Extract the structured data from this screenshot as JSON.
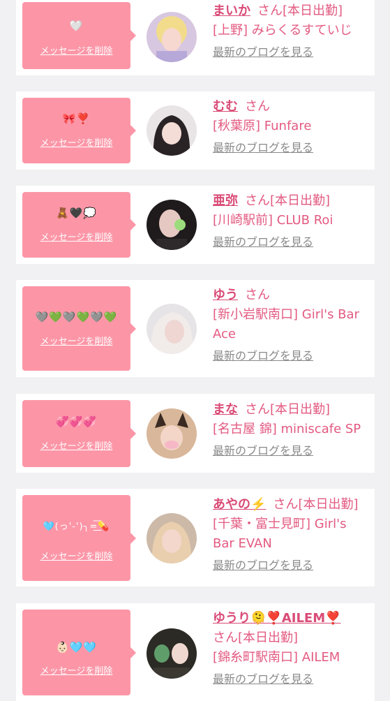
{
  "colors": {
    "accent": "#fc96a7",
    "name": "#d94b76",
    "text_pink": "#e35a81",
    "link_gray": "#8a8a8a",
    "background": "#f1f1f3"
  },
  "delete_label": "メッセージを削除",
  "blog_label": "最新のブログを見る",
  "items": [
    {
      "message": "🤍",
      "name": "まいか",
      "status": "さん[本日出勤]",
      "shop": "[上野] みらくるすていじ"
    },
    {
      "message": "🎀❣️",
      "name": "むむ",
      "status": "さん",
      "shop": "[秋葉原] Funfare"
    },
    {
      "message": "🧸🖤💭",
      "name": "亜弥",
      "status": "さん[本日出勤]",
      "shop": "[川崎駅前] CLUB Roi"
    },
    {
      "message": "🩶💚🩶💚🩶💚",
      "name": "ゆう",
      "status": "さん",
      "shop": "[新小岩駅南口] Girl's Bar Ace"
    },
    {
      "message": "💞💞💞",
      "name": "まな",
      "status": "さん[本日出勤]",
      "shop": "[名古屋 錦] miniscafe SP"
    },
    {
      "message": "🩵(っ'-')╮=͟͟͞͞💊",
      "name": "あやの⚡️",
      "status": "さん[本日出勤]",
      "shop": "[千葉・富士見町] Girl's Bar EVAN"
    },
    {
      "message": "👶🏻🩵🩵",
      "name": "ゆうり🫠❣️AILEM❣️",
      "status": "さん[本日出勤]",
      "shop": "[錦糸町駅南口] AILEM"
    }
  ]
}
